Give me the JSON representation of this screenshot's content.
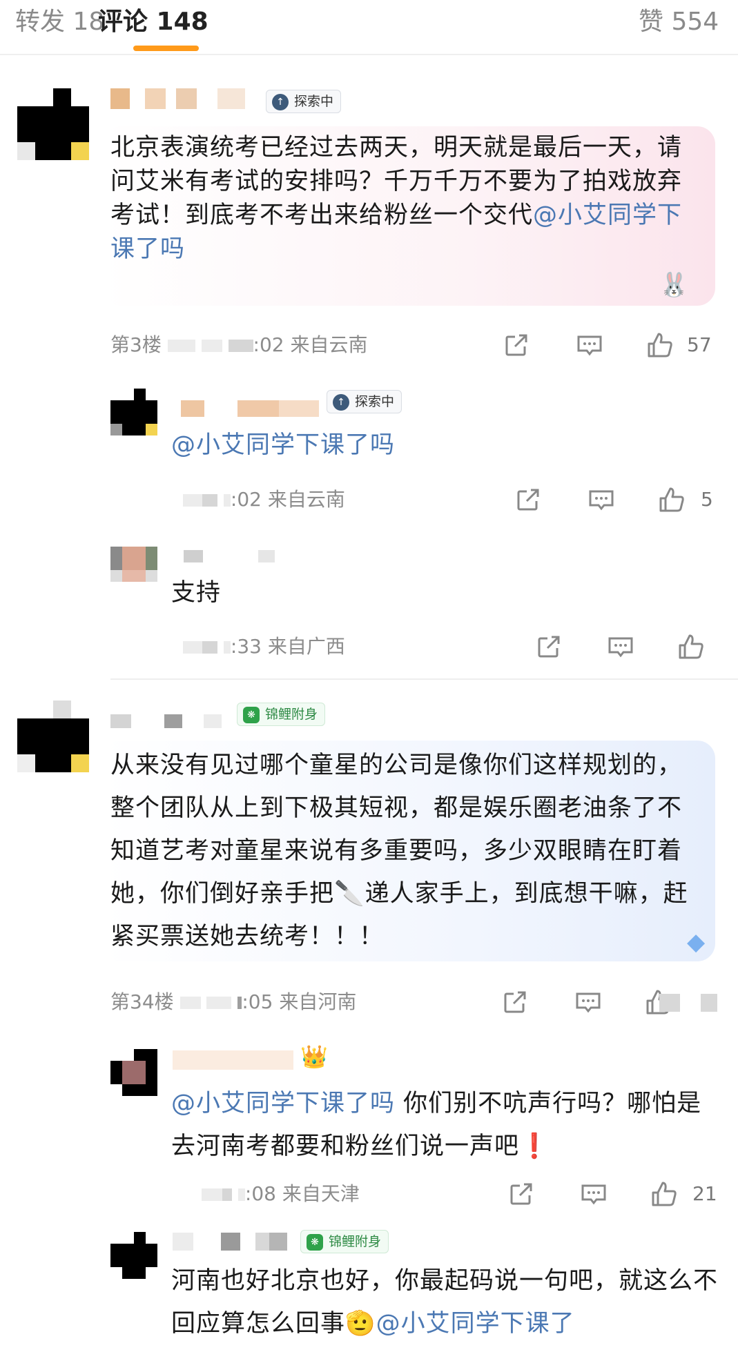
{
  "tabs": {
    "repost": "转发 18",
    "comments": "评论 148",
    "likes": "赞 554"
  },
  "colors": {
    "accent": "#ff9a1a",
    "mention": "#4b78b3",
    "meta": "#8c8c8c"
  },
  "comments": [
    {
      "badge": "探索中",
      "text_main": "北京表演统考已经过去两天，明天就是最后一天，请问艾米有考试的安排吗？千万千万不要为了拍戏放弃考试！到底考不考出来给粉丝一个交代",
      "mention": "@小艾同学下课了吗",
      "floor": "第3楼",
      "time_suffix": ":02",
      "location": "来自云南",
      "like_count": "57",
      "replies": [
        {
          "badge": "探索中",
          "mention": "@小艾同学下课了吗",
          "time_suffix": ":02",
          "location": "来自云南",
          "like_count": "5"
        },
        {
          "text": "支持",
          "time_suffix": ":33",
          "location": "来自广西",
          "like_count": ""
        }
      ]
    },
    {
      "badge": "锦鲤附身",
      "text_main": "从来没有见过哪个童星的公司是像你们这样规划的，整个团队从上到下极其短视，都是娱乐圈老油条了不知道艺考对童星来说有多重要吗，多少双眼睛在盯着她，你们倒好亲手把🔪递人家手上，到底想干嘛，赶紧买票送她去统考！！！",
      "floor": "第34楼",
      "time_suffix": ":05",
      "location": "来自河南",
      "replies": [
        {
          "mention": "@小艾同学下课了吗",
          "text": " 你们别不吭声行吗？哪怕是去河南考都要和粉丝们说一声吧❗",
          "time_suffix": ":08",
          "location": "来自天津",
          "like_count": "21"
        },
        {
          "badge": "锦鲤附身",
          "text": "河南也好北京也好，你最起码说一句吧，就这么不回应算怎么回事🫡",
          "mention": "@小艾同学下课了"
        }
      ]
    }
  ],
  "icons": [
    "share-icon",
    "comment-icon",
    "like-icon",
    "explore-badge-icon",
    "koi-badge-icon",
    "crown-icon"
  ]
}
